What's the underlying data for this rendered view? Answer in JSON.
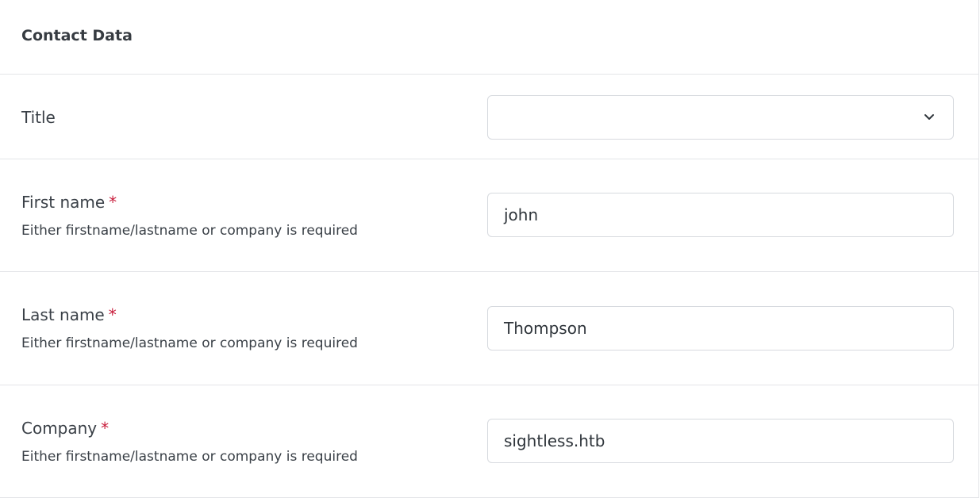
{
  "section": {
    "title": "Contact Data"
  },
  "fields": {
    "title": {
      "label": "Title",
      "value": ""
    },
    "first_name": {
      "label": "First name",
      "required_marker": "*",
      "help": "Either firstname/lastname or company is required",
      "value": "john"
    },
    "last_name": {
      "label": "Last name",
      "required_marker": "*",
      "help": "Either firstname/lastname or company is required",
      "value": "Thompson"
    },
    "company": {
      "label": "Company",
      "required_marker": "*",
      "help": "Either firstname/lastname or company is required",
      "value": "sightless.htb"
    }
  },
  "icons": {
    "select_arrow": "chevron-down-icon"
  },
  "colors": {
    "required": "#c81c3b",
    "border": "#d7dadf",
    "divider": "#e3e5e8"
  }
}
